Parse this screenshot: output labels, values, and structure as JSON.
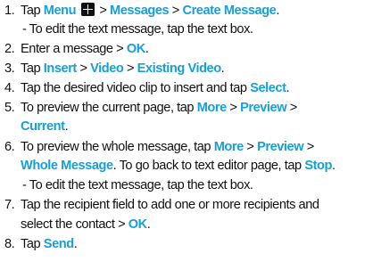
{
  "steps": [
    {
      "num": "1.",
      "pre": "Tap ",
      "menu": "Menu",
      "sep1": " > ",
      "messages": "Messages",
      "sep2": " > ",
      "create": "Create Message",
      "end": ".",
      "note": "- To edit the text message, tap the text box."
    },
    {
      "num": "2.",
      "pre": "Enter a message > ",
      "ok": "OK",
      "end": "."
    },
    {
      "num": "3.",
      "pre": "Tap ",
      "insert": "Insert",
      "sep1": " > ",
      "video": "Video",
      "sep2": " > ",
      "existing": "Existing Video",
      "end": "."
    },
    {
      "num": "4.",
      "pre": "Tap the desired video clip to insert and tap ",
      "select": "Select",
      "end": "."
    },
    {
      "num": "5.",
      "pre": "To preview the current page, tap ",
      "more": "More",
      "sep1": " > ",
      "preview": "Preview",
      "sep2": " >",
      "current": "Current",
      "end": "."
    },
    {
      "num": "6.",
      "pre": "To preview the whole message, tap ",
      "more": "More",
      "sep1": " > ",
      "preview": "Preview",
      "sep2": " >",
      "whole": "Whole Message",
      "mid": ". To go back to text editor page, tap ",
      "stop": "Stop",
      "end": ".",
      "note": "- To edit the text message, tap the text box."
    },
    {
      "num": "7.",
      "line1": "Tap the recipient field to add one or more recipients and",
      "line2_pre": "select the contact > ",
      "ok": "OK",
      "end": "."
    },
    {
      "num": "8.",
      "pre": "Tap ",
      "send": "Send",
      "end": "."
    }
  ],
  "colors": {
    "accent": "#17a0d6",
    "text": "#111111"
  },
  "icons": {
    "menu": "grid-menu-icon"
  }
}
